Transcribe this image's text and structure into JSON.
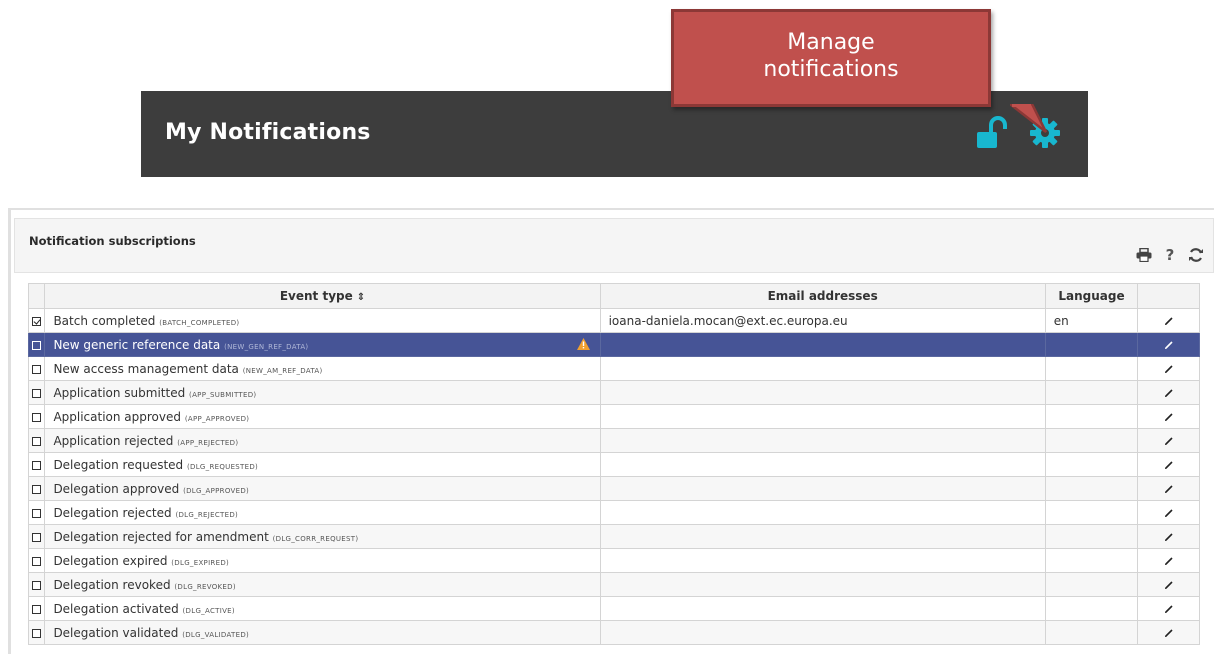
{
  "header": {
    "title": "My Notifications",
    "accent_color": "#18b7cf",
    "lock_icon": "unlock-icon",
    "gear_icon": "gear-icon"
  },
  "callout": {
    "text_line1": "Manage",
    "text_line2": "notifications",
    "color": "#c0504d"
  },
  "panel": {
    "title": "Notification subscriptions",
    "toolbar": {
      "print_icon": "print-icon",
      "help_label": "?",
      "refresh_icon": "refresh-icon"
    }
  },
  "table": {
    "columns": {
      "event_type": "Event type",
      "event_sort_glyph": "⇕",
      "email": "Email addresses",
      "language": "Language"
    },
    "selected_row_color": "#465496",
    "rows": [
      {
        "label": "Batch completed",
        "code": "(BATCH_COMPLETED)",
        "email": "ioana-daniela.mocan@ext.ec.europa.eu",
        "language": "en",
        "checked": true
      },
      {
        "label": "New generic reference data",
        "code": "(NEW_GEN_REF_DATA)",
        "email": "",
        "language": "",
        "checked": false,
        "selected": true,
        "warning": true
      },
      {
        "label": "New access management data",
        "code": "(NEW_AM_REF_DATA)",
        "email": "",
        "language": "",
        "checked": false
      },
      {
        "label": "Application submitted",
        "code": "(APP_SUBMITTED)",
        "email": "",
        "language": "",
        "checked": false
      },
      {
        "label": "Application approved",
        "code": "(APP_APPROVED)",
        "email": "",
        "language": "",
        "checked": false
      },
      {
        "label": "Application rejected",
        "code": "(APP_REJECTED)",
        "email": "",
        "language": "",
        "checked": false
      },
      {
        "label": "Delegation requested",
        "code": "(DLG_REQUESTED)",
        "email": "",
        "language": "",
        "checked": false
      },
      {
        "label": "Delegation approved",
        "code": "(DLG_APPROVED)",
        "email": "",
        "language": "",
        "checked": false
      },
      {
        "label": "Delegation rejected",
        "code": "(DLG_REJECTED)",
        "email": "",
        "language": "",
        "checked": false
      },
      {
        "label": "Delegation rejected for amendment",
        "code": "(DLG_CORR_REQUEST)",
        "email": "",
        "language": "",
        "checked": false
      },
      {
        "label": "Delegation expired",
        "code": "(DLG_EXPIRED)",
        "email": "",
        "language": "",
        "checked": false
      },
      {
        "label": "Delegation revoked",
        "code": "(DLG_REVOKED)",
        "email": "",
        "language": "",
        "checked": false
      },
      {
        "label": "Delegation activated",
        "code": "(DLG_ACTIVE)",
        "email": "",
        "language": "",
        "checked": false
      },
      {
        "label": "Delegation validated",
        "code": "(DLG_VALIDATED)",
        "email": "",
        "language": "",
        "checked": false
      }
    ]
  }
}
